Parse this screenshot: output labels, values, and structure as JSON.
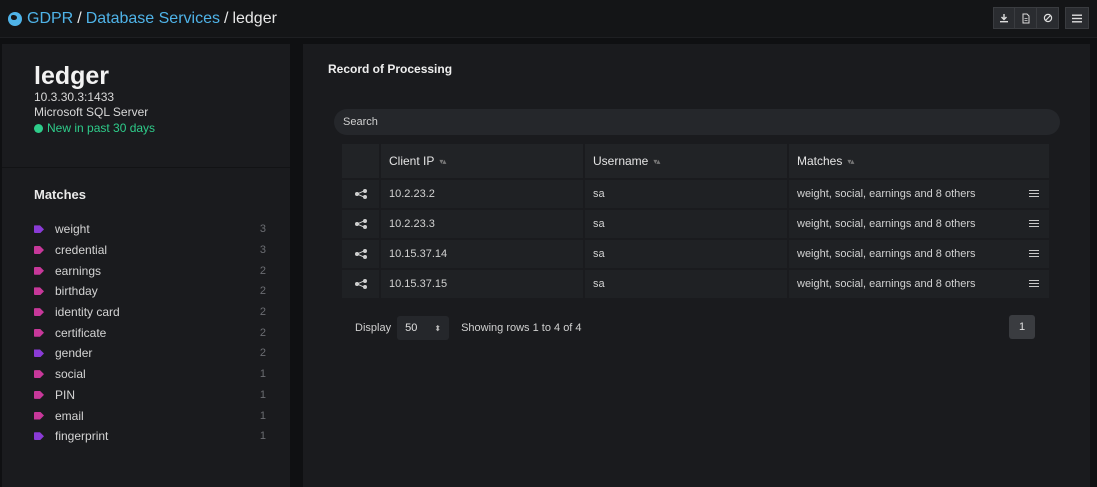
{
  "breadcrumb": {
    "root": "GDPR",
    "sep1": "/",
    "section": "Database Services",
    "sep2": "/",
    "current": "ledger"
  },
  "toolbar": {
    "icons": [
      "download-icon",
      "document-icon",
      "ban-icon",
      "menu-icon"
    ]
  },
  "asset": {
    "name": "ledger",
    "address": "10.3.30.3:1433",
    "type": "Microsoft SQL Server",
    "status": "New in past 30 days",
    "status_color": "#2ecc8a"
  },
  "matches": {
    "title": "Matches",
    "items": [
      {
        "label": "weight",
        "count": "3",
        "color": "#8a3bd6"
      },
      {
        "label": "credential",
        "count": "3",
        "color": "#c7389a"
      },
      {
        "label": "earnings",
        "count": "2",
        "color": "#c7389a"
      },
      {
        "label": "birthday",
        "count": "2",
        "color": "#c7389a"
      },
      {
        "label": "identity card",
        "count": "2",
        "color": "#c7389a"
      },
      {
        "label": "certificate",
        "count": "2",
        "color": "#c7389a"
      },
      {
        "label": "gender",
        "count": "2",
        "color": "#8a3bd6"
      },
      {
        "label": "social",
        "count": "1",
        "color": "#c7389a"
      },
      {
        "label": "PIN",
        "count": "1",
        "color": "#c7389a"
      },
      {
        "label": "email",
        "count": "1",
        "color": "#c7389a"
      },
      {
        "label": "fingerprint",
        "count": "1",
        "color": "#8a3bd6"
      }
    ]
  },
  "record": {
    "title": "Record of Processing",
    "search_placeholder": "Search",
    "columns": [
      "Client IP",
      "Username",
      "Matches"
    ],
    "rows": [
      {
        "ip": "10.2.23.2",
        "user": "sa",
        "matches": "weight, social, earnings and 8 others"
      },
      {
        "ip": "10.2.23.3",
        "user": "sa",
        "matches": "weight, social, earnings and 8 others"
      },
      {
        "ip": "10.15.37.14",
        "user": "sa",
        "matches": "weight, social, earnings and 8 others"
      },
      {
        "ip": "10.15.37.15",
        "user": "sa",
        "matches": "weight, social, earnings and 8 others"
      }
    ],
    "display_label": "Display",
    "page_size": "50",
    "showing": "Showing rows 1 to 4 of 4",
    "page": "1"
  }
}
